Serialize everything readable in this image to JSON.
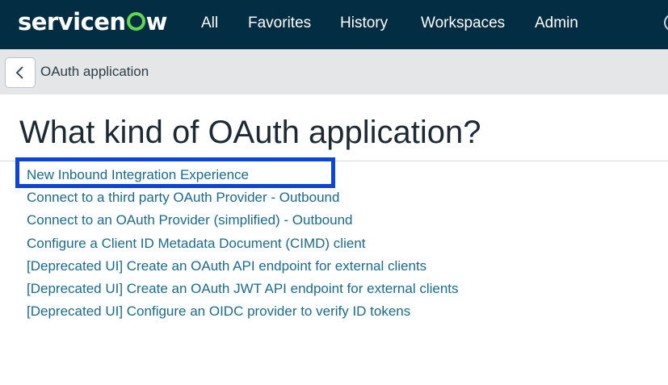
{
  "header": {
    "logo_text_pre": "servicen",
    "logo_text_post": "w",
    "nav": [
      "All",
      "Favorites",
      "History",
      "Workspaces",
      "Admin"
    ],
    "brand_accent": "#62d84e",
    "bar_color": "#032d42"
  },
  "subheader": {
    "back_icon": "chevron-left-icon",
    "title": "OAuth application"
  },
  "main": {
    "heading": "What kind of OAuth application?",
    "options": [
      "New Inbound Integration Experience",
      "Connect to a third party OAuth Provider - Outbound",
      "Connect to an OAuth Provider (simplified) - Outbound",
      "Configure a Client ID Metadata Document (CIMD) client",
      "[Deprecated UI] Create an OAuth API endpoint for external clients",
      "[Deprecated UI] Create an OAuth JWT API endpoint for external clients",
      "[Deprecated UI] Configure an OIDC provider to verify ID tokens"
    ],
    "highlighted_option": "New Inbound Integration Experience",
    "highlight_color": "#0b46d7",
    "link_color": "#1a6b8a"
  }
}
